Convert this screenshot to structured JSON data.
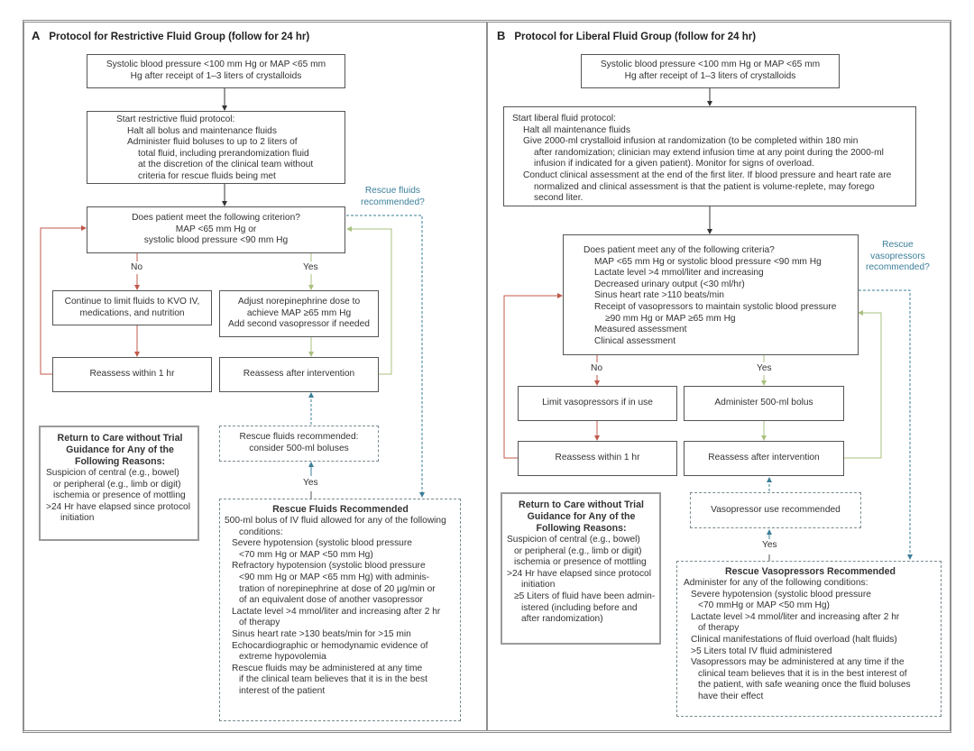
{
  "colors": {
    "no_path": "#c0584a",
    "yes_path": "#a9c17e",
    "rescue_path": "#3b7f9a",
    "box_border": "#555555"
  },
  "panelA": {
    "letter": "A",
    "title": "Protocol for Restrictive Fluid Group (follow for 24 hr)",
    "entry": [
      "Systolic blood pressure <100 mm Hg or MAP <65 mm",
      "Hg after receipt of  1–3 liters of crystalloids"
    ],
    "start": {
      "heading": "Start restrictive fluid protocol:",
      "lines": [
        {
          "text": "Halt all bolus and maintenance fluids",
          "indent": 1
        },
        {
          "text": "Administer fluid boluses to up to 2 liters of",
          "indent": 1
        },
        {
          "text": "total fluid, including prerandomization fluid",
          "indent": 2
        },
        {
          "text": "at the discretion of the clinical team without",
          "indent": 2
        },
        {
          "text": "criteria for rescue fluids being met",
          "indent": 2
        }
      ]
    },
    "decision": [
      "Does patient meet the following criterion?",
      "MAP <65 mm Hg or",
      "systolic blood pressure <90 mm Hg"
    ],
    "no_label": "No",
    "yes_label": "Yes",
    "no_action": [
      "Continue to limit fluids to KVO IV,",
      "medications, and nutrition"
    ],
    "yes_action": [
      "Adjust norepinephrine dose to",
      "achieve MAP ≥65 mm Hg",
      "Add second vasopressor if needed"
    ],
    "reassess_no": "Reassess within 1 hr",
    "reassess_yes": "Reassess after intervention",
    "rescue_question": [
      "Rescue fluids",
      "recommended?"
    ],
    "rescue_short": [
      "Rescue fluids recommended:",
      "consider 500-ml boluses"
    ],
    "rescue_yes_label": "Yes",
    "return_box": {
      "heading": [
        "Return to Care without Trial",
        "Guidance for Any of the",
        "Following Reasons:"
      ],
      "lines": [
        {
          "text": "Suspicion of central (e.g., bowel)",
          "indent": 0
        },
        {
          "text": "or peripheral (e.g., limb or digit)",
          "indent": 1
        },
        {
          "text": "ischemia or presence of mottling",
          "indent": 1
        },
        {
          "text": ">24 Hr have elapsed since protocol",
          "indent": 0
        },
        {
          "text": "initiation",
          "indent": 2
        }
      ]
    },
    "rescue_box": {
      "heading": "Rescue Fluids Recommended",
      "lines": [
        {
          "text": "500-ml bolus of IV fluid allowed for any of the following",
          "indent": 0
        },
        {
          "text": "conditions:",
          "indent": 2
        },
        {
          "text": "Severe hypotension (systolic blood pressure",
          "indent": 1
        },
        {
          "text": "<70 mm Hg or MAP <50 mm Hg)",
          "indent": 2
        },
        {
          "text": "Refractory hypotension (systolic blood pressure",
          "indent": 1
        },
        {
          "text": "<90 mm Hg or MAP <65 mm Hg) with adminis-",
          "indent": 2
        },
        {
          "text": "tration of norepinephrine at dose of 20 μg/min or",
          "indent": 2
        },
        {
          "text": "of an equivalent dose of another vasopressor",
          "indent": 2
        },
        {
          "text": "Lactate level >4 mmol/liter and increasing after 2 hr",
          "indent": 1
        },
        {
          "text": "of therapy",
          "indent": 2
        },
        {
          "text": "Sinus heart rate >130 beats/min for >15 min",
          "indent": 1
        },
        {
          "text": "Echocardiographic or hemodynamic evidence of",
          "indent": 1
        },
        {
          "text": "extreme hypovolemia",
          "indent": 2
        },
        {
          "text": "Rescue fluids may be administered at any time",
          "indent": 1
        },
        {
          "text": "if the clinical team believes that it is in the best",
          "indent": 2
        },
        {
          "text": "interest of the patient",
          "indent": 2
        }
      ]
    }
  },
  "panelB": {
    "letter": "B",
    "title": "Protocol for Liberal Fluid Group (follow for 24 hr)",
    "entry": [
      "Systolic blood pressure <100 mm Hg or MAP <65 mm",
      "Hg after receipt of  1–3 liters of crystalloids"
    ],
    "start": {
      "heading": "Start liberal fluid protocol:",
      "lines": [
        {
          "text": "Halt all maintenance fluids",
          "indent": 1
        },
        {
          "text": "Give 2000-ml crystalloid infusion at randomization (to be completed within 180 min",
          "indent": 1
        },
        {
          "text": "after randomization; clinician may extend infusion time at any point during the 2000-ml",
          "indent": 2
        },
        {
          "text": "infusion if indicated for a given patient). Monitor for signs of overload.",
          "indent": 2
        },
        {
          "text": "Conduct clinical assessment at the end of the first liter. If blood pressure and heart rate are",
          "indent": 1
        },
        {
          "text": "normalized and clinical assessment is that the patient is volume-replete, may forego",
          "indent": 2
        },
        {
          "text": "second liter.",
          "indent": 2
        }
      ]
    },
    "decision": {
      "heading": "Does patient meet any of the following criteria?",
      "lines": [
        {
          "text": "MAP <65 mm Hg or systolic blood pressure <90 mm Hg",
          "indent": 1
        },
        {
          "text": "Lactate level  >4 mmol/liter and increasing",
          "indent": 1
        },
        {
          "text": "Decreased urinary output (<30 ml/hr)",
          "indent": 1
        },
        {
          "text": "Sinus heart rate  >110 beats/min",
          "indent": 1
        },
        {
          "text": "Receipt of vasopressors to maintain systolic blood pressure",
          "indent": 1
        },
        {
          "text": "≥90 mm Hg or MAP ≥65 mm Hg",
          "indent": 2
        },
        {
          "text": "Measured assessment",
          "indent": 1
        },
        {
          "text": "Clinical assessment",
          "indent": 1
        }
      ]
    },
    "no_label": "No",
    "yes_label": "Yes",
    "no_action": "Limit vasopressors if in use",
    "yes_action": "Administer 500-ml bolus",
    "reassess_no": "Reassess within 1 hr",
    "reassess_yes": "Reassess after intervention",
    "rescue_question": [
      "Rescue",
      "vasopressors",
      "recommended?"
    ],
    "rescue_short": "Vasopressor use recommended",
    "rescue_yes_label": "Yes",
    "return_box": {
      "heading": [
        "Return to Care without Trial",
        "Guidance for Any of the",
        "Following Reasons:"
      ],
      "lines": [
        {
          "text": "Suspicion of central (e.g., bowel)",
          "indent": 0
        },
        {
          "text": "or peripheral (e.g., limb or digit)",
          "indent": 1
        },
        {
          "text": "ischemia or presence of mottling",
          "indent": 1
        },
        {
          "text": ">24 Hr have elapsed since protocol",
          "indent": 0
        },
        {
          "text": "initiation",
          "indent": 2
        },
        {
          "text": "≥5 Liters of fluid have been admin-",
          "indent": 1
        },
        {
          "text": "istered (including before and",
          "indent": 2
        },
        {
          "text": "after randomization)",
          "indent": 2
        }
      ]
    },
    "rescue_box": {
      "heading": "Rescue Vasopressors Recommended",
      "lines": [
        {
          "text": "Administer for any of the following conditions:",
          "indent": 0
        },
        {
          "text": "Severe hypotension (systolic blood pressure",
          "indent": 1
        },
        {
          "text": "<70 mmHg or MAP <50 mm Hg)",
          "indent": 2
        },
        {
          "text": "Lactate level  >4 mmol/liter and increasing after 2 hr",
          "indent": 1
        },
        {
          "text": "of therapy",
          "indent": 2
        },
        {
          "text": "Clinical manifestations of fluid overload  (halt fluids)",
          "indent": 1
        },
        {
          "text": ">5 Liters total IV fluid administered",
          "indent": 1
        },
        {
          "text": "Vasopressors may be administered at any time if the",
          "indent": 1
        },
        {
          "text": "clinical team believes that it is in the best interest of",
          "indent": 2
        },
        {
          "text": "the patient, with safe weaning once the fluid boluses",
          "indent": 2
        },
        {
          "text": "have their effect",
          "indent": 2
        }
      ]
    }
  }
}
